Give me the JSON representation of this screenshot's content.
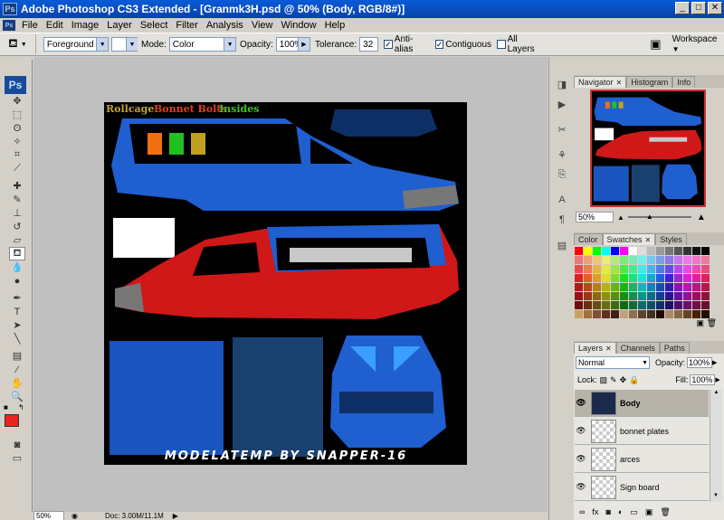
{
  "window": {
    "title": "Adobe Photoshop CS3 Extended - [Granmk3H.psd @ 50% (Body, RGB/8#)]",
    "app_badge": "Ps"
  },
  "menu": [
    "File",
    "Edit",
    "Image",
    "Layer",
    "Select",
    "Filter",
    "Analysis",
    "View",
    "Window",
    "Help"
  ],
  "options": {
    "fill_source": "Foreground",
    "mode_label": "Mode:",
    "mode_value": "Color",
    "opacity_label": "Opacity:",
    "opacity_value": "100%",
    "tolerance_label": "Tolerance:",
    "tolerance_value": "32",
    "antialias_label": "Anti-alias",
    "contiguous_label": "Contiguous",
    "alllayers_label": "All Layers",
    "workspace_label": "Workspace"
  },
  "toolbox": {
    "badge": "Ps"
  },
  "canvas": {
    "labels": {
      "rollcage": "Rollcage",
      "bonnet": "Bonnet Bolts",
      "insides": "Insides"
    },
    "footer": "MODELATEMP BY SNAPPER-16",
    "colors": {
      "rollcage": "#c2a33a",
      "bonnet": "#e0401a",
      "insides": "#3fbf2f",
      "body_blue": "#1f5fd0",
      "body_red": "#d01818"
    }
  },
  "status": {
    "zoom": "50%",
    "doc": "Doc: 3.00M/11.1M"
  },
  "navigator": {
    "tabs": [
      "Navigator",
      "Histogram",
      "Info"
    ],
    "zoom": "50%"
  },
  "swatches": {
    "tabs": [
      "Color",
      "Swatches",
      "Styles"
    ]
  },
  "layers": {
    "tabs": [
      "Layers",
      "Channels",
      "Paths"
    ],
    "blend_mode": "Normal",
    "opacity_label": "Opacity:",
    "opacity_value": "100%",
    "lock_label": "Lock:",
    "fill_label": "Fill:",
    "fill_value": "100%",
    "items": [
      {
        "name": "Body"
      },
      {
        "name": "bonnet plates"
      },
      {
        "name": "arces"
      },
      {
        "name": "Sign board"
      }
    ],
    "footer_icons": [
      "link-icon",
      "fx-icon",
      "mask-icon",
      "adjustment-icon",
      "folder-icon",
      "new-layer-icon",
      "trash-icon"
    ]
  }
}
